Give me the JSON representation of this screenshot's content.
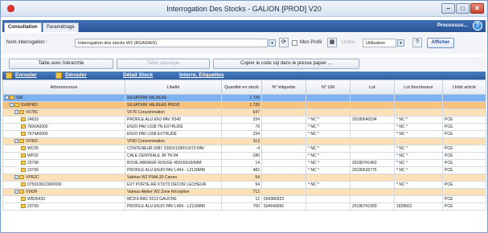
{
  "window": {
    "title": "Interrogation Des Stocks - GALION [PROD] V20"
  },
  "tabs": [
    "Consultation",
    "Paramétrage"
  ],
  "processus_label": "Processus...",
  "query": {
    "label": "Nom interrogation :",
    "value": "Interrogation des stocks W2 (RGADAIS)",
    "mon_profil_label": "Mon Profil",
    "units_label": "Unités",
    "units_value": "Utilisation",
    "afficher_label": "Afficher"
  },
  "actions": {
    "table_hierarchy": "Table avec hiérarchie",
    "table_classic": "Table classique",
    "copy_sql": "Copier le code sql dans le presse papier ..."
  },
  "nav": {
    "enrouler": "Enrouler",
    "derouler": "Dérouler",
    "detail_stock": "Détail Stock",
    "interro_etiquettes": "Interro. Etiquettes"
  },
  "columns": [
    "Arborescence",
    "Libellé",
    "Quantité en stock",
    "N° étiquette",
    "N° UM",
    "Lot",
    "Lot fournisseur",
    "Unité article"
  ],
  "rows": [
    {
      "level": 0,
      "code": "SIR",
      "label": "SILVATRIM VALREAS",
      "qty": "1 726",
      "etiq": "",
      "um": "",
      "lot": "",
      "lotf": "",
      "unit": ""
    },
    {
      "level": 1,
      "code": "SVRPRD",
      "label": "SILVATRIM VALREAS PROD",
      "qty": "1 726",
      "etiq": "",
      "um": "",
      "lot": "",
      "lotf": "",
      "unit": ""
    },
    {
      "level": 2,
      "code": "VF78C",
      "label": "VF78 Consommation",
      "qty": "647",
      "etiq": "",
      "um": "",
      "lot": "",
      "lotf": "",
      "unit": ""
    },
    {
      "level": 3,
      "code": "24633",
      "label": "PROFILE ALU ENJ PAV X540",
      "qty": "334",
      "etiq": "",
      "um": "* NC *",
      "lot": "20180640194",
      "lotf": "* NC *",
      "unit": "PCE"
    },
    {
      "level": 3,
      "code": "7600A0000",
      "label": "ENJO PAV L538 TN EXTRUDÉ",
      "qty": "79",
      "etiq": "",
      "um": "* NC *",
      "lot": "",
      "lotf": "* NC *",
      "unit": "PCE"
    },
    {
      "level": 3,
      "code": "7674A0000",
      "label": "ENJO PAV L558 EXTRUDÉ",
      "qty": "234",
      "etiq": "",
      "um": "* NC *",
      "lot": "",
      "lotf": "* NC *",
      "unit": "PCE"
    },
    {
      "level": 2,
      "code": "VF90C",
      "label": "VF90 Consommation",
      "qty": "313",
      "etiq": "",
      "um": "",
      "lot": "",
      "lotf": "",
      "unit": ""
    },
    {
      "level": 3,
      "code": "WC05",
      "label": "CONTENEUR 0087 2300X1300X1070 PAV",
      "qty": "-4",
      "etiq": "",
      "um": "* NC *",
      "lot": "",
      "lotf": "* NC *",
      "unit": "PCE"
    },
    {
      "level": 3,
      "code": "WP32",
      "label": "CALE CENTRALE JR TN 84",
      "qty": "-180",
      "etiq": "",
      "um": "* NC *",
      "lot": "",
      "lotf": "* NC *",
      "unit": "PCE"
    },
    {
      "level": 3,
      "code": "23798",
      "label": "ROUE ABRASIF ROUGE 450X55X60MM",
      "qty": "14",
      "etiq": "",
      "um": "* NC *",
      "lot": "20180741460",
      "lotf": "* NC *",
      "unit": "PCE"
    },
    {
      "level": 3,
      "code": "23799",
      "label": "PROFILE ALU ENJO PAV L494 - L2130MM",
      "qty": "483",
      "etiq": "",
      "um": "* NC *",
      "lot": "20180535775",
      "lotf": "* NC *",
      "unit": "PCE"
    },
    {
      "level": 2,
      "code": "VPR2C",
      "label": "Valréas W2 P944,30 Carreo",
      "qty": "54",
      "etiq": "",
      "um": "",
      "lot": "",
      "lotf": "",
      "unit": ""
    },
    {
      "level": 3,
      "code": "0759100C0000000",
      "label": "EXT PORTE AR X72/73 DECOR LECHEUR",
      "qty": "54",
      "etiq": "",
      "um": "* NC *",
      "lot": "",
      "lotf": "* NC *",
      "unit": "PCE"
    },
    {
      "level": 2,
      "code": "VW2R",
      "label": "Valreas Atelier W2 Zone Réception",
      "qty": "712",
      "etiq": "",
      "um": "",
      "lot": "",
      "lotf": "",
      "unit": ""
    },
    {
      "level": 3,
      "code": "WB36433",
      "label": "MCDS BAC 5213 GAUCHE",
      "qty": "12",
      "etiq": "504380923",
      "um": "",
      "lot": "",
      "lotf": "",
      "unit": "PCE"
    },
    {
      "level": 3,
      "code": "23799",
      "label": "PROFILE ALU ENJO PAV L494 - L2130MM",
      "qty": "700",
      "etiq": "504640066",
      "um": "",
      "lot": "20180741900",
      "lotf": "1828001",
      "unit": "PCE"
    }
  ]
}
